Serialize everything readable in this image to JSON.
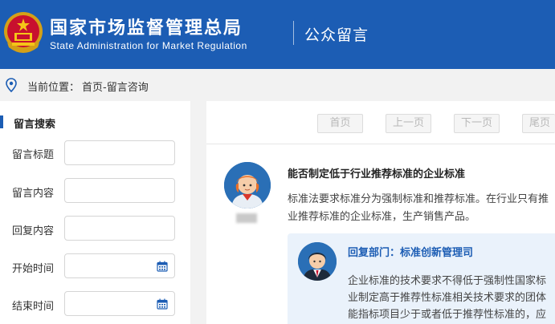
{
  "header": {
    "title_cn": "国家市场监督管理总局",
    "title_en": "State Administration for Market Regulation",
    "section": "公众留言"
  },
  "location": {
    "label": "当前位置：",
    "path": "首页-留言咨询"
  },
  "sidebar": {
    "title": "留言搜索",
    "fields": [
      {
        "label": "留言标题",
        "value": ""
      },
      {
        "label": "留言内容",
        "value": ""
      },
      {
        "label": "回复内容",
        "value": ""
      },
      {
        "label": "开始时间",
        "value": ""
      },
      {
        "label": "结束时间",
        "value": ""
      }
    ]
  },
  "pager": {
    "first": "首页",
    "prev": "上一页",
    "next": "下一页",
    "last": "尾页"
  },
  "message": {
    "title": "能否制定低于行业推荐标准的企业标准",
    "lines": [
      "标准法要求标准分为强制标准和推荐标准。在行业只有推",
      "业推荐标准的企业标准，生产销售产品。"
    ],
    "reply": {
      "dept": "回复部门：标准创新管理司",
      "lines": [
        "企业标准的技术要求不得低于强制性国家标",
        "业制定高于推荐性标准相关技术要求的团体",
        "能指标项目少于或者低于推荐性标准的，应"
      ]
    }
  },
  "colors": {
    "brand_blue": "#1c5db4",
    "reply_bg": "#eaf2fb"
  }
}
